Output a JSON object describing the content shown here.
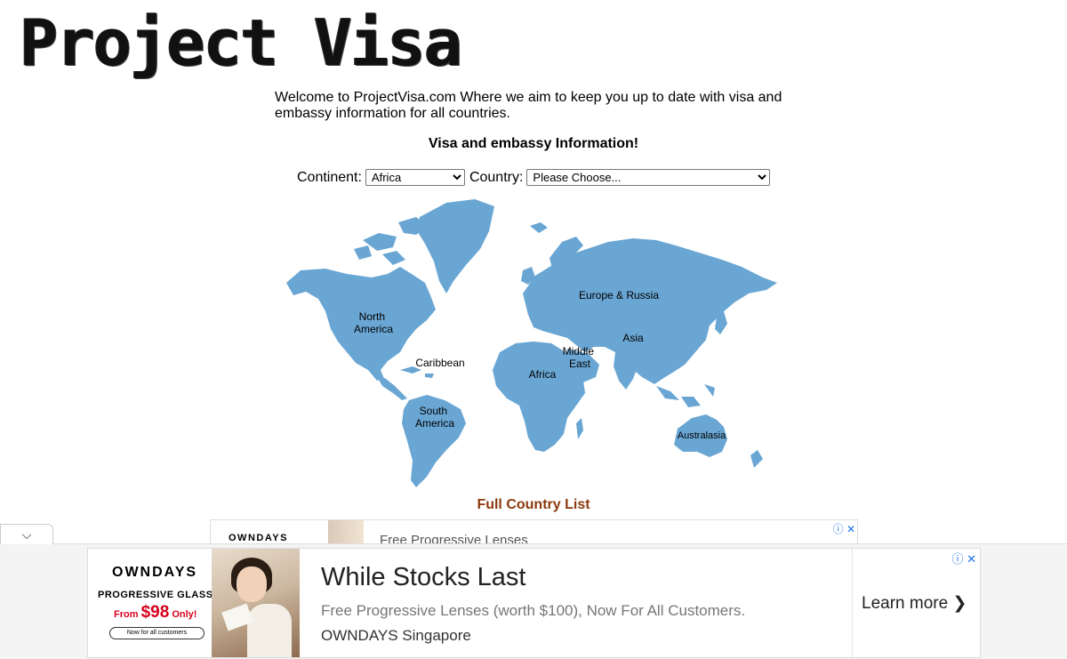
{
  "site": {
    "logo": "Project Visa",
    "welcome": "Welcome to ProjectVisa.com Where we aim to keep you up to date with visa and embassy information for all countries.",
    "section_title": "Visa and embassy Information!"
  },
  "selectors": {
    "continent_label": "Continent:",
    "continent_value": "Africa",
    "country_label": "Country:",
    "country_value": "Please Choose..."
  },
  "map": {
    "land_color": "#6aa6d4",
    "regions": {
      "north_america": [
        "North",
        "America"
      ],
      "caribbean": "Caribbean",
      "south_america": [
        "South",
        "America"
      ],
      "europe_russia": "Europe & Russia",
      "middle_east": [
        "Middle",
        "East"
      ],
      "africa": "Africa",
      "asia": "Asia",
      "australasia": "Australasia"
    }
  },
  "full_list_link": "Full Country List",
  "inline_ad": {
    "brand": "OWNDAYS",
    "text": "Free Progressive Lenses",
    "icons": "ⓘ ✕"
  },
  "sticky_ad": {
    "collapse": "⌵",
    "brand": "OWNDAYS",
    "product": "PROGRESSIVE GLASSES",
    "price_from": "From ",
    "price_value": "$98",
    "price_suffix": " Only!",
    "pill": "Now for all customers",
    "headline": "While Stocks Last",
    "description": "Free Progressive Lenses (worth $100), Now For All Customers.",
    "advertiser": "OWNDAYS Singapore",
    "cta": "Learn more",
    "cta_arrow": "❯",
    "icons": "ⓘ ✕"
  }
}
